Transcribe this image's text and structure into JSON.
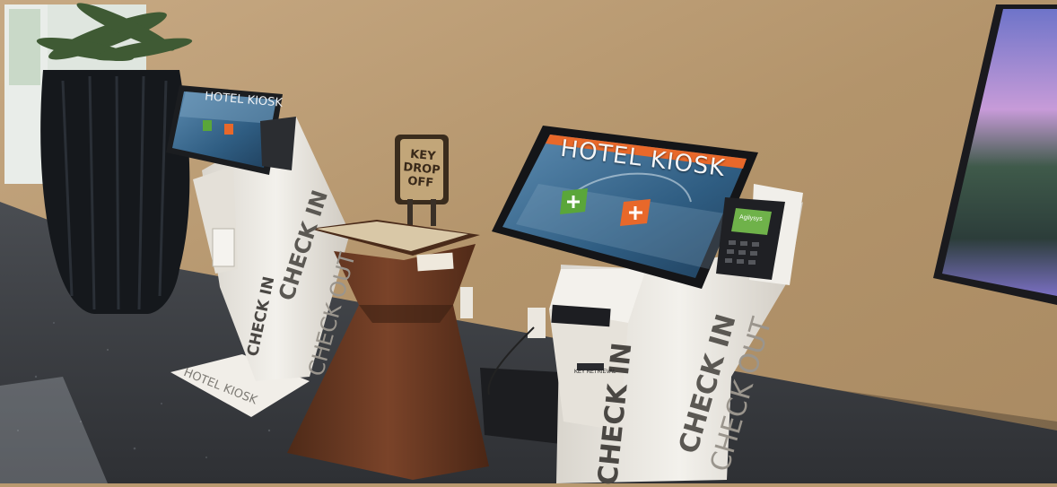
{
  "kiosk_main": {
    "screen_title": "HOTEL KIOSK",
    "side_check_in": "CHECK IN",
    "side_check_out": "CHECK OUT",
    "slot_label": "KEY RETRIEVAL",
    "card_reader_brand": "Agilysys"
  },
  "kiosk_secondary": {
    "screen_title": "HOTEL KIOSK",
    "side_check_in": "CHECK IN",
    "side_check_out": "CHECK OUT",
    "floor_mat_text": "HOTEL KIOSK"
  },
  "key_drop": {
    "sign_line1": "KEY DROP",
    "sign_line2": "OFF"
  },
  "colors": {
    "wall": "#b8996f",
    "floor": "#3c3f44",
    "kiosk_body": "#ece9e3",
    "screen_blue": "#2d5a7e",
    "accent_orange": "#e8682a",
    "accent_green": "#5aa63a",
    "pedestal": "#6b3b24"
  },
  "icons": [
    "plant-icon",
    "plus-icon",
    "card-reader-icon"
  ]
}
